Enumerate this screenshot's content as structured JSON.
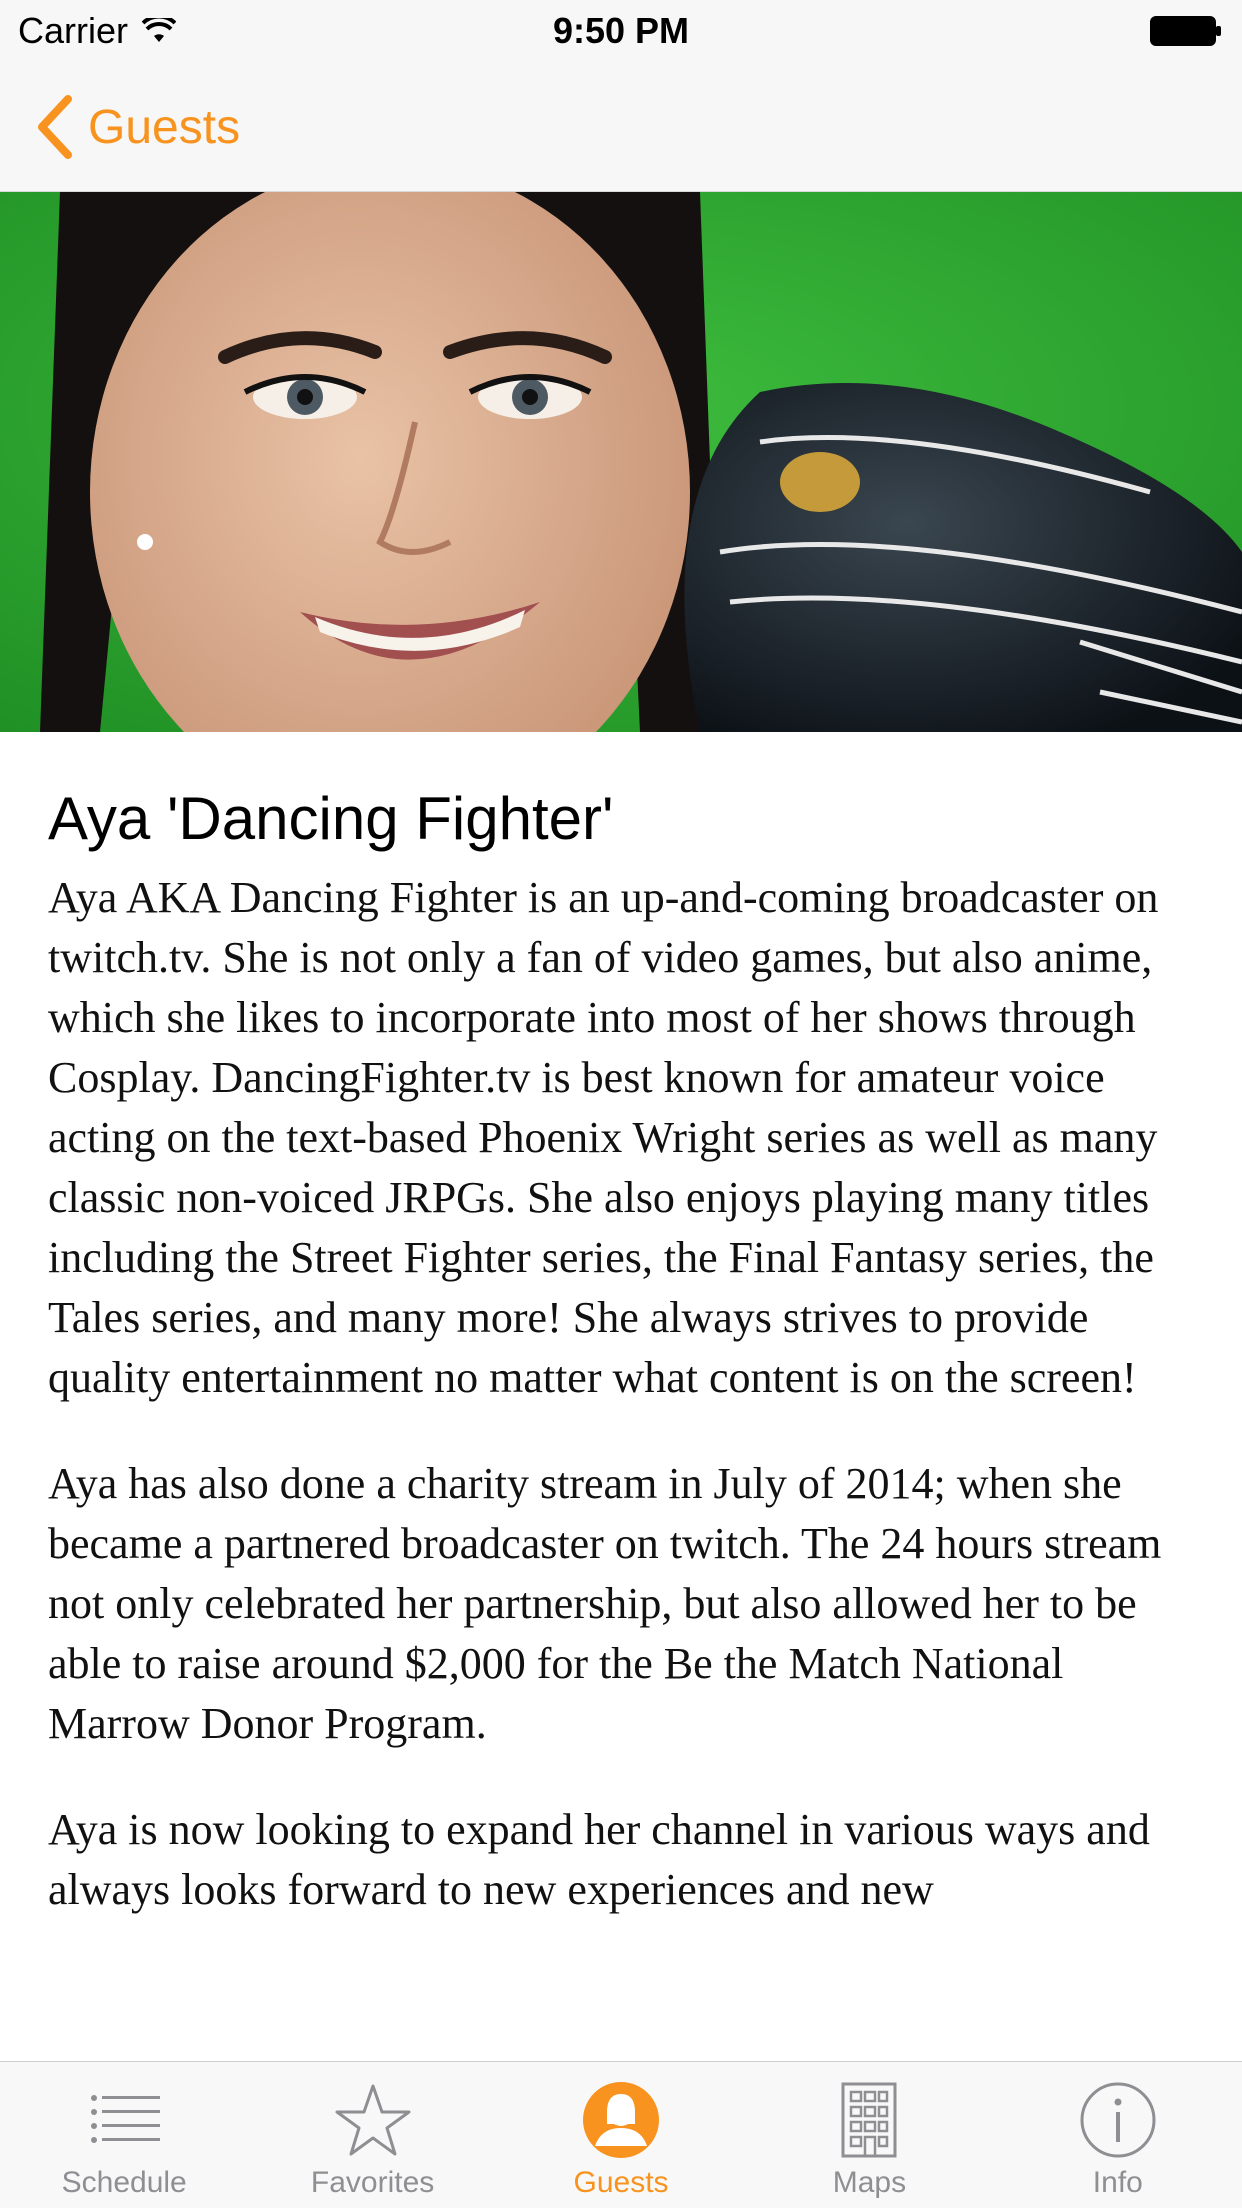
{
  "status_bar": {
    "carrier": "Carrier",
    "time": "9:50 PM"
  },
  "nav": {
    "back_label": "Guests"
  },
  "guest": {
    "name": "Aya 'Dancing Fighter'",
    "bio": [
      "Aya AKA Dancing Fighter is an up-and-coming broadcaster on twitch.tv. She is not only a fan of video games, but also anime, which she likes to incorporate into most of her shows through Cosplay. DancingFighter.tv is best known for amateur voice acting on the text-based Phoenix Wright series as well as many classic non-voiced JRPGs. She also enjoys playing many titles including the Street Fighter series, the Final Fantasy series, the Tales series, and many more! She always strives to provide quality entertainment no matter what content is on the screen!",
      "Aya has also done a charity stream in July of 2014; when she became a partnered broadcaster on twitch. The 24 hours stream not only celebrated her partnership, but also allowed her to be able to raise around $2,000 for the Be the Match National Marrow Donor Program.",
      "Aya is now looking to expand her channel in various ways and always looks forward to new experiences and new"
    ]
  },
  "tab_bar": {
    "tabs": [
      {
        "label": "Schedule",
        "icon": "list-icon",
        "active": false
      },
      {
        "label": "Favorites",
        "icon": "star-icon",
        "active": false
      },
      {
        "label": "Guests",
        "icon": "person-icon",
        "active": true
      },
      {
        "label": "Maps",
        "icon": "building-icon",
        "active": false
      },
      {
        "label": "Info",
        "icon": "info-icon",
        "active": false
      }
    ]
  },
  "colors": {
    "accent": "#f7931e",
    "inactive": "#8e8e93",
    "hero_background": "#2aa32a"
  }
}
